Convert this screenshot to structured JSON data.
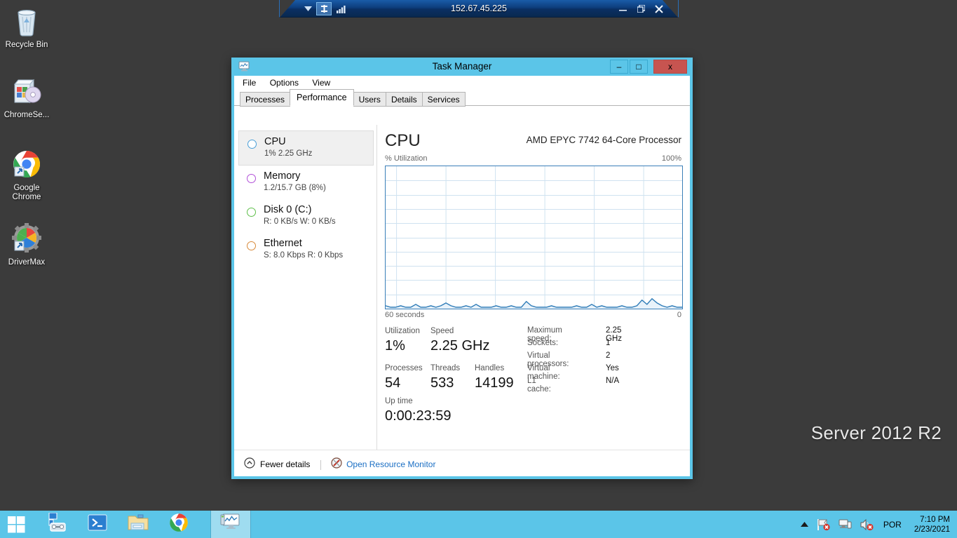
{
  "desktop": {
    "icons": [
      {
        "name": "Recycle Bin",
        "icon": "recycle-bin-icon"
      },
      {
        "name": "ChromeSe...",
        "icon": "installer-disc-icon"
      },
      {
        "name": "Google Chrome",
        "icon": "chrome-icon"
      },
      {
        "name": "DriverMax",
        "icon": "drivermax-icon"
      }
    ],
    "watermark": "Server 2012 R2"
  },
  "rdp_bar": {
    "address": "152.67.45.225",
    "dropdown_icon": "chevron-down-icon",
    "pin_icon": "pushpin-icon",
    "signal_icon": "connection-quality-icon",
    "minimize_label": "–",
    "restore_label": "❐",
    "close_label": "✕"
  },
  "task_manager": {
    "title": "Task Manager",
    "app_icon": "task-manager-icon",
    "window_buttons": {
      "minimize": "–",
      "maximize": "□",
      "close": "x"
    },
    "menu": [
      "File",
      "Options",
      "View"
    ],
    "tabs": [
      {
        "label": "Processes",
        "active": false
      },
      {
        "label": "Performance",
        "active": true
      },
      {
        "label": "Users",
        "active": false
      },
      {
        "label": "Details",
        "active": false
      },
      {
        "label": "Services",
        "active": false
      }
    ],
    "resources": [
      {
        "name": "CPU",
        "sub": "1% 2.25 GHz",
        "color": "#4a9fd8",
        "selected": true
      },
      {
        "name": "Memory",
        "sub": "1.2/15.7 GB (8%)",
        "color": "#b14fd8",
        "selected": false
      },
      {
        "name": "Disk 0 (C:)",
        "sub": "R: 0 KB/s  W: 0 KB/s",
        "color": "#5fbf4a",
        "selected": false
      },
      {
        "name": "Ethernet",
        "sub": "S: 8.0 Kbps  R: 0 Kbps",
        "color": "#d88a3a",
        "selected": false
      }
    ],
    "detail": {
      "heading": "CPU",
      "model": "AMD EPYC 7742 64-Core Processor",
      "graph_axis_label": "% Utilization",
      "graph_axis_max": "100%",
      "graph_time_label": "60 seconds",
      "graph_time_min": "0",
      "stats": [
        {
          "label": "Utilization",
          "value": "1%"
        },
        {
          "label": "Speed",
          "value": "2.25 GHz"
        },
        {
          "label": "Processes",
          "value": "54"
        },
        {
          "label": "Threads",
          "value": "533"
        },
        {
          "label": "Handles",
          "value": "14199"
        }
      ],
      "uptime_label": "Up time",
      "uptime_value": "0:00:23:59",
      "system_info": [
        {
          "key": "Maximum speed:",
          "value": "2.25 GHz"
        },
        {
          "key": "Sockets:",
          "value": "1"
        },
        {
          "key": "Virtual processors:",
          "value": "2"
        },
        {
          "key": "Virtual machine:",
          "value": "Yes"
        },
        {
          "key": "L1 cache:",
          "value": "N/A"
        }
      ]
    },
    "footer": {
      "fewer_details": "Fewer details",
      "fewer_icon": "chevron-up-circle-icon",
      "resource_monitor": "Open Resource Monitor",
      "resource_monitor_icon": "resource-monitor-icon"
    }
  },
  "chart_data": {
    "type": "area",
    "title": "CPU % Utilization",
    "ylabel": "% Utilization",
    "xlabel": "60 seconds",
    "ylim": [
      0,
      100
    ],
    "xlim": [
      60,
      0
    ],
    "grid": true,
    "grid_rows": 10,
    "grid_cols": 6,
    "series": [
      {
        "name": "CPU Utilization",
        "color": "#2f7cb8",
        "fill": "#e8f2fa",
        "values": [
          2,
          1,
          1,
          2,
          1,
          1,
          3,
          1,
          1,
          2,
          1,
          2,
          4,
          2,
          1,
          1,
          2,
          1,
          3,
          1,
          1,
          1,
          2,
          1,
          1,
          2,
          1,
          1,
          5,
          2,
          1,
          1,
          1,
          2,
          1,
          1,
          1,
          1,
          2,
          1,
          1,
          3,
          1,
          2,
          1,
          1,
          1,
          2,
          1,
          1,
          2,
          6,
          3,
          7,
          4,
          2,
          1,
          2,
          1,
          1
        ]
      }
    ]
  },
  "taskbar": {
    "start_icon": "windows-start-icon",
    "buttons": [
      {
        "icon": "server-manager-icon",
        "active": false
      },
      {
        "icon": "powershell-icon",
        "active": false
      },
      {
        "icon": "file-explorer-icon",
        "active": false
      },
      {
        "icon": "chrome-icon",
        "active": false
      },
      {
        "icon": "task-manager-icon",
        "active": true
      }
    ],
    "tray": {
      "expand_icon": "show-hidden-icons-arrow",
      "flag_icon": "action-center-flag-icon",
      "network_icon": "network-icon",
      "volume_icon": "volume-muted-icon",
      "language": "POR",
      "time": "7:10 PM",
      "date": "2/23/2021"
    }
  },
  "colors": {
    "accent": "#5bc5e8",
    "desktop": "#3b3b3b",
    "graph_line": "#2f7cb8",
    "link": "#1b6fc4",
    "close_red": "#c75450"
  }
}
